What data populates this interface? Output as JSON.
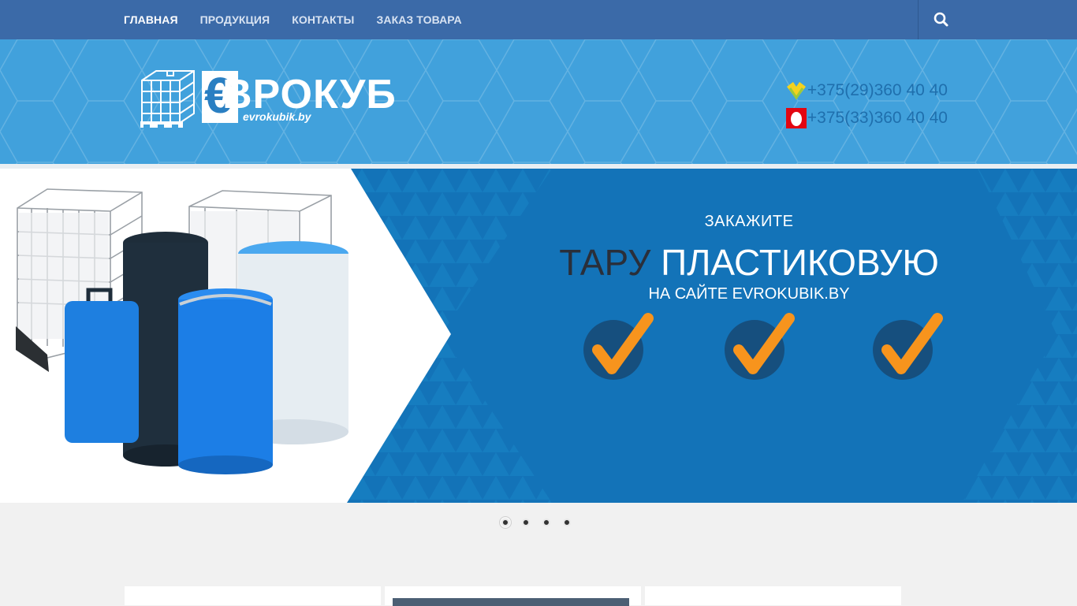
{
  "nav": {
    "items": [
      {
        "label": "ГЛАВНАЯ"
      },
      {
        "label": "ПРОДУКЦИЯ"
      },
      {
        "label": "КОНТАКТЫ"
      },
      {
        "label": "ЗАКАЗ ТОВАРА"
      }
    ],
    "search_icon": "search-icon"
  },
  "header": {
    "logo_name": "ВРОКУБ",
    "logo_euro": "€",
    "logo_domain": "evrokubik.by",
    "phones": [
      {
        "operator_icon": "velcom-icon",
        "number": "+375(29)360 40 40"
      },
      {
        "operator_icon": "mts-icon",
        "number": "+375(33)360 40 40"
      }
    ]
  },
  "slider": {
    "line1": "ЗАКАЖИТЕ",
    "line2_dark": "ТАРУ",
    "line2_light": "ПЛАСТИКОВУЮ",
    "line3": "НА САЙТЕ EVROKUBIK.BY",
    "dots": 4,
    "active_dot": 0
  },
  "colors": {
    "nav_bg": "#3b6aa8",
    "header_bg": "#41a1dc",
    "slider_bg": "#1373b8",
    "check_orange": "#f7941d"
  }
}
